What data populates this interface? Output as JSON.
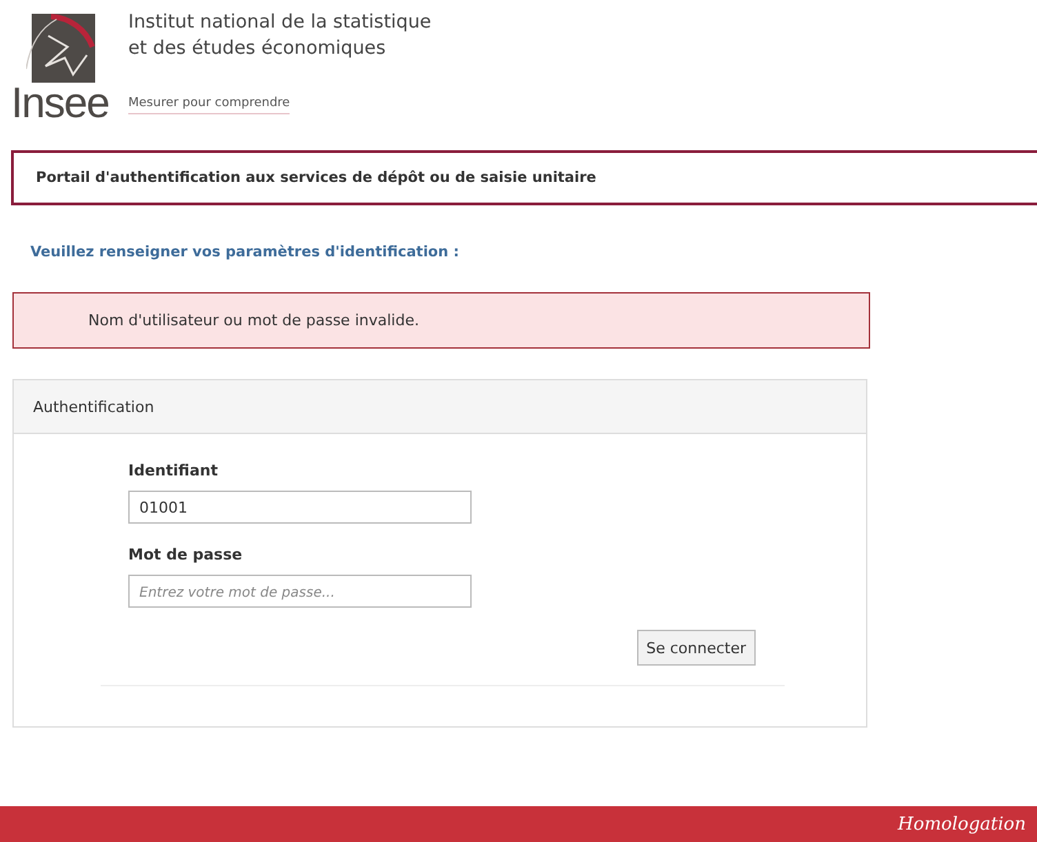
{
  "header": {
    "logo_text": "Insee",
    "institution": [
      "Institut national de la statistique",
      "et des études économiques"
    ],
    "tagline": "Mesurer pour comprendre"
  },
  "banner": {
    "title": "Portail d'authentification aux services de dépôt ou de saisie unitaire"
  },
  "instruction": "Veuillez renseigner vos paramètres d'identification :",
  "error": "Nom d'utilisateur ou mot de passe invalide.",
  "panel": {
    "title": "Authentification",
    "fields": [
      {
        "label": "Identifiant",
        "value": "01001"
      },
      {
        "label": "Mot de passe",
        "placeholder": "Entrez votre mot de passe..."
      }
    ],
    "submit": "Se connecter"
  },
  "footer": {
    "environment": "Homologation"
  }
}
